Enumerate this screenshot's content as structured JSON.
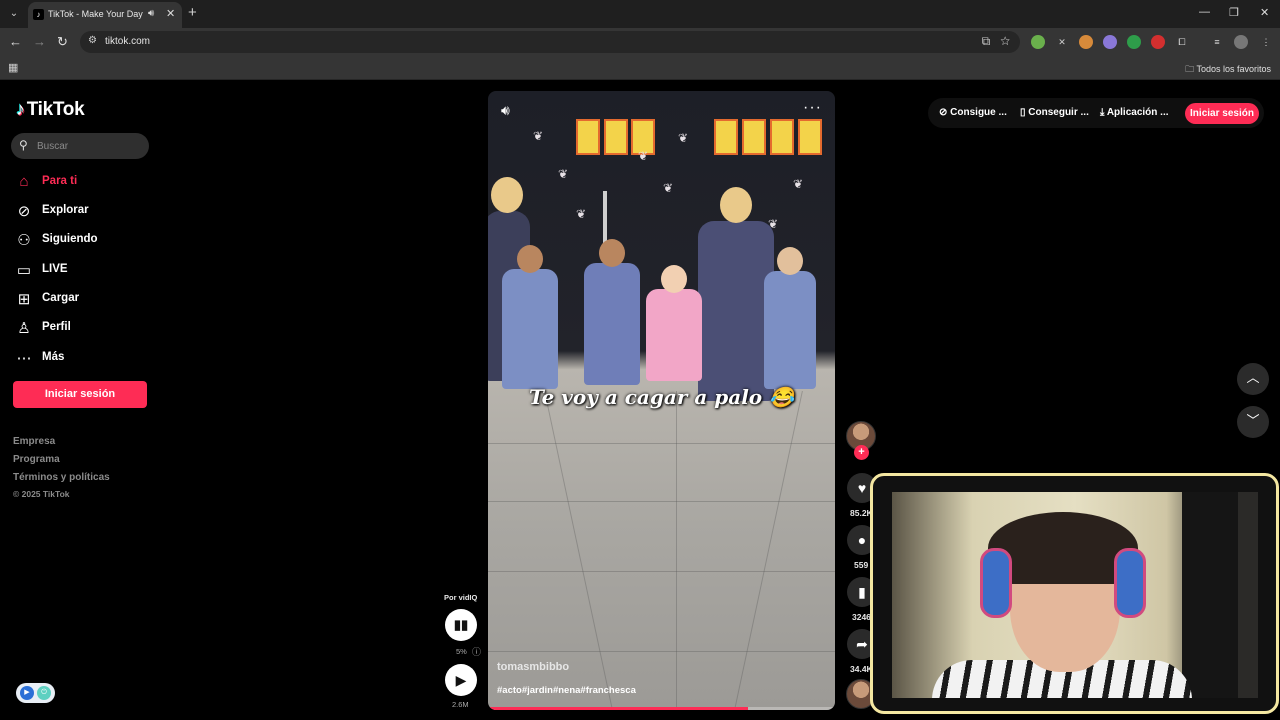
{
  "browser": {
    "tab_title": "TikTok - Make Your Day",
    "url": "tiktok.com",
    "bookmarks_folder": "Todos los favoritos"
  },
  "sidebar": {
    "logo": "TikTok",
    "search_placeholder": "Buscar",
    "nav": [
      {
        "label": "Para ti",
        "icon": "home-icon",
        "active": true
      },
      {
        "label": "Explorar",
        "icon": "compass-icon"
      },
      {
        "label": "Siguiendo",
        "icon": "following-icon"
      },
      {
        "label": "LIVE",
        "icon": "live-icon"
      },
      {
        "label": "Cargar",
        "icon": "upload-icon"
      },
      {
        "label": "Perfil",
        "icon": "profile-icon"
      },
      {
        "label": "Más",
        "icon": "more-icon"
      }
    ],
    "login_button": "Iniciar sesión",
    "footer_links": [
      "Empresa",
      "Programa",
      "Términos y políticas"
    ],
    "copyright": "© 2025 TikTok"
  },
  "video": {
    "caption": "Te voy a cagar a palo 😂",
    "author": "tomasmbibbo",
    "hashtags": "#acto#jardin#nena#franchesca",
    "progress_pct": 75
  },
  "vidiq": {
    "label": "Por vidIQ",
    "score": "5%",
    "views": "2.6M"
  },
  "actions": {
    "likes": "85.2K",
    "comments": "559",
    "saves": "3246",
    "shares": "34.4K"
  },
  "top_bar": {
    "coins": "Consigue ...",
    "app": "Conseguir ...",
    "desktop": "Aplicación ...",
    "login": "Iniciar sesión"
  },
  "colors": {
    "brand": "#fe2c55",
    "cyan": "#25f4ee",
    "webcam_border": "#f4e7a1"
  }
}
